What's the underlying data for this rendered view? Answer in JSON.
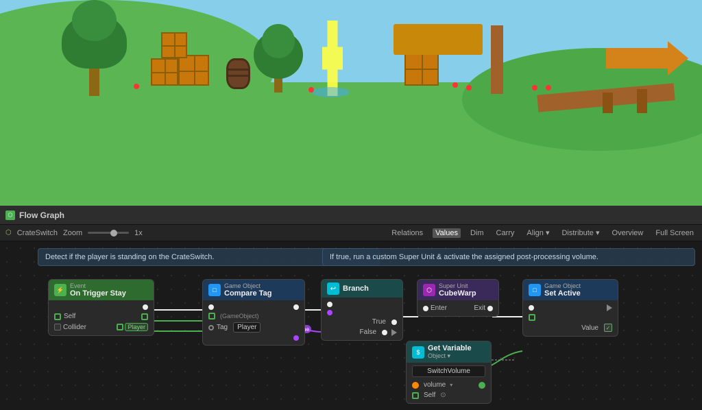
{
  "titleBar": {
    "title": "Flow Graph",
    "icon": "flow-graph-icon"
  },
  "toolbar": {
    "breadcrumb": "CrateSwitch",
    "zoom_label": "Zoom",
    "zoom_value": "1x",
    "buttons": [
      "Relations",
      "Values",
      "Dim",
      "Carry",
      "Align ▾",
      "Distribute ▾",
      "Overview",
      "Full Screen"
    ]
  },
  "descriptions": {
    "left": "Detect if the player is standing on the CrateSwitch.",
    "right": "If true, run a custom Super Unit & activate the assigned post-processing volume."
  },
  "nodes": {
    "trigger": {
      "header_sub": "Event",
      "header_main": "On Trigger Stay",
      "ports_out": [
        "Self",
        "Collider"
      ],
      "port_labels": [
        "Self",
        "Collider",
        "Player"
      ]
    },
    "compare_tag": {
      "header_sub": "Game Object",
      "header_main": "Compare Tag",
      "tag_value": "Player"
    },
    "branch": {
      "header_main": "Branch",
      "ports": [
        "True",
        "False"
      ]
    },
    "super_unit": {
      "header_sub": "Super Unit",
      "header_main": "CubeWarp",
      "ports": [
        "Enter",
        "Exit"
      ]
    },
    "set_active": {
      "header_sub": "Game Object",
      "header_main": "Set Active",
      "port": "Value"
    },
    "get_variable": {
      "header_main": "Get Variable",
      "header_sub": "Object ▾",
      "ports": [
        "volume",
        "Self"
      ],
      "label": "SwitchVolume"
    }
  }
}
